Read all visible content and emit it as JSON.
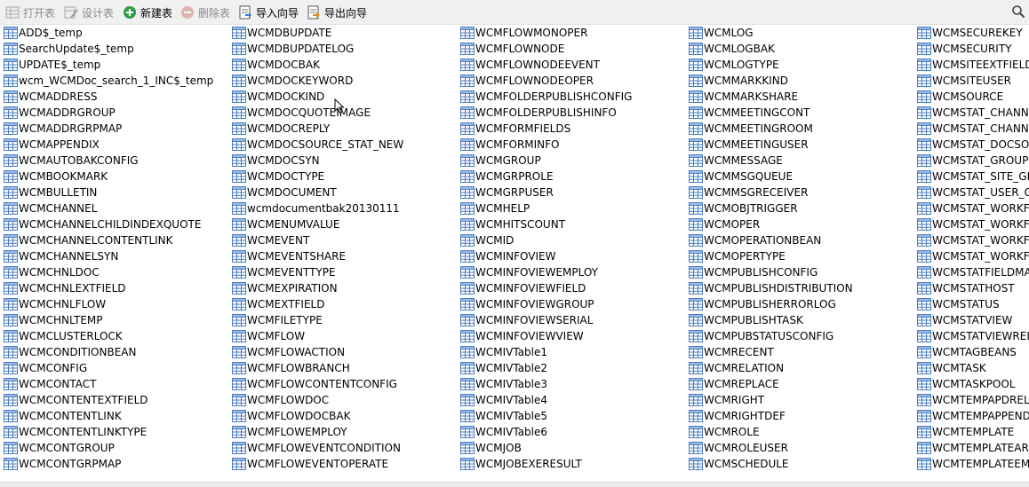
{
  "toolbar": {
    "open_table": "打开表",
    "design_table": "设计表",
    "new_table": "新建表",
    "delete_table": "删除表",
    "import_wizard": "导入向导",
    "export_wizard": "导出向导"
  },
  "colors": {
    "toolbar_bg": "#f0f0f0",
    "table_icon_blue": "#4a7dbf",
    "new_icon_green": "#2f9e44",
    "delete_icon_red": "#c24a3c",
    "disabled_text": "#8a8a8a"
  },
  "icons": [
    "open-table-icon",
    "design-table-icon",
    "new-table-icon",
    "delete-table-icon",
    "import-wizard-icon",
    "export-wizard-icon",
    "search-icon",
    "table-icon"
  ],
  "columns": [
    [
      "ADD$_temp",
      "SearchUpdate$_temp",
      "UPDATE$_temp",
      "wcm_WCMDoc_search_1_INC$_temp",
      "WCMADDRESS",
      "WCMADDRGROUP",
      "WCMADDRGRPMAP",
      "WCMAPPENDIX",
      "WCMAUTOBAKCONFIG",
      "WCMBOOKMARK",
      "WCMBULLETIN",
      "WCMCHANNEL",
      "WCMCHANNELCHILDINDEXQUOTE",
      "WCMCHANNELCONTENTLINK",
      "WCMCHANNELSYN",
      "WCMCHNLDOC",
      "WCMCHNLEXTFIELD",
      "WCMCHNLFLOW",
      "WCMCHNLTEMP",
      "WCMCLUSTERLOCK",
      "WCMCONDITIONBEAN",
      "WCMCONFIG",
      "WCMCONTACT",
      "WCMCONTENTEXTFIELD",
      "WCMCONTENTLINK",
      "WCMCONTENTLINKTYPE",
      "WCMCONTGROUP",
      "WCMCONTGRPMAP"
    ],
    [
      "WCMDBUPDATE",
      "WCMDBUPDATELOG",
      "WCMDOCBAK",
      "WCMDOCKEYWORD",
      "WCMDOCKIND",
      "WCMDOCQUOTEIMAGE",
      "WCMDOCREPLY",
      "WCMDOCSOURCE_STAT_NEW",
      "WCMDOCSYN",
      "WCMDOCTYPE",
      "WCMDOCUMENT",
      "wcmdocumentbak20130111",
      "WCMENUMVALUE",
      "WCMEVENT",
      "WCMEVENTSHARE",
      "WCMEVENTTYPE",
      "WCMEXPIRATION",
      "WCMEXTFIELD",
      "WCMFILETYPE",
      "WCMFLOW",
      "WCMFLOWACTION",
      "WCMFLOWBRANCH",
      "WCMFLOWCONTENTCONFIG",
      "WCMFLOWDOC",
      "WCMFLOWDOCBAK",
      "WCMFLOWEMPLOY",
      "WCMFLOWEVENTCONDITION",
      "WCMFLOWEVENTOPERATE"
    ],
    [
      "WCMFLOWMONOPER",
      "WCMFLOWNODE",
      "WCMFLOWNODEEVENT",
      "WCMFLOWNODEOPER",
      "WCMFOLDERPUBLISHCONFIG",
      "WCMFOLDERPUBLISHINFO",
      "WCMFORMFIELDS",
      "WCMFORMINFO",
      "WCMGROUP",
      "WCMGRPROLE",
      "WCMGRPUSER",
      "WCMHELP",
      "WCMHITSCOUNT",
      "WCMID",
      "WCMINFOVIEW",
      "WCMINFOVIEWEMPLOY",
      "WCMINFOVIEWFIELD",
      "WCMINFOVIEWGROUP",
      "WCMINFOVIEWSERIAL",
      "WCMINFOVIEWVIEW",
      "WCMIVTable1",
      "WCMIVTable2",
      "WCMIVTable3",
      "WCMIVTable4",
      "WCMIVTable5",
      "WCMIVTable6",
      "WCMJOB",
      "WCMJOBEXERESULT"
    ],
    [
      "WCMLOG",
      "WCMLOGBAK",
      "WCMLOGTYPE",
      "WCMMARKKIND",
      "WCMMARKSHARE",
      "WCMMEETINGCONT",
      "WCMMEETINGROOM",
      "WCMMEETINGUSER",
      "WCMMESSAGE",
      "WCMMSGQUEUE",
      "WCMMSGRECEIVER",
      "WCMOBJTRIGGER",
      "WCMOPER",
      "WCMOPERATIONBEAN",
      "WCMOPERTYPE",
      "WCMPUBLISHCONFIG",
      "WCMPUBLISHDISTRIBUTION",
      "WCMPUBLISHERRORLOG",
      "WCMPUBLISHTASK",
      "WCMPUBSTATUSCONFIG",
      "WCMRECENT",
      "WCMRELATION",
      "WCMREPLACE",
      "WCMRIGHT",
      "WCMRIGHTDEF",
      "WCMROLE",
      "WCMROLEUSER",
      "WCMSCHEDULE"
    ],
    [
      "WCMSECUREKEY",
      "WCMSECURITY",
      "WCMSITEEXTFIELD",
      "WCMSITEUSER",
      "WCMSOURCE",
      "WCMSTAT_CHANN",
      "WCMSTAT_CHANN",
      "WCMSTAT_DOCSO",
      "WCMSTAT_GROUP",
      "WCMSTAT_SITE_GE",
      "WCMSTAT_USER_G",
      "WCMSTAT_WORKF",
      "WCMSTAT_WORKF",
      "WCMSTAT_WORKF",
      "WCMSTAT_WORKF",
      "WCMSTATFIELDMA",
      "WCMSTATHOST",
      "WCMSTATUS",
      "WCMSTATVIEW",
      "WCMSTATVIEWREL",
      "WCMTAGBEANS",
      "WCMTASK",
      "WCMTASKPOOL",
      "WCMTEMPAPDREL",
      "WCMTEMPAPPEND",
      "WCMTEMPLATE",
      "WCMTEMPLATEAR",
      "WCMTEMPLATEEM"
    ]
  ]
}
